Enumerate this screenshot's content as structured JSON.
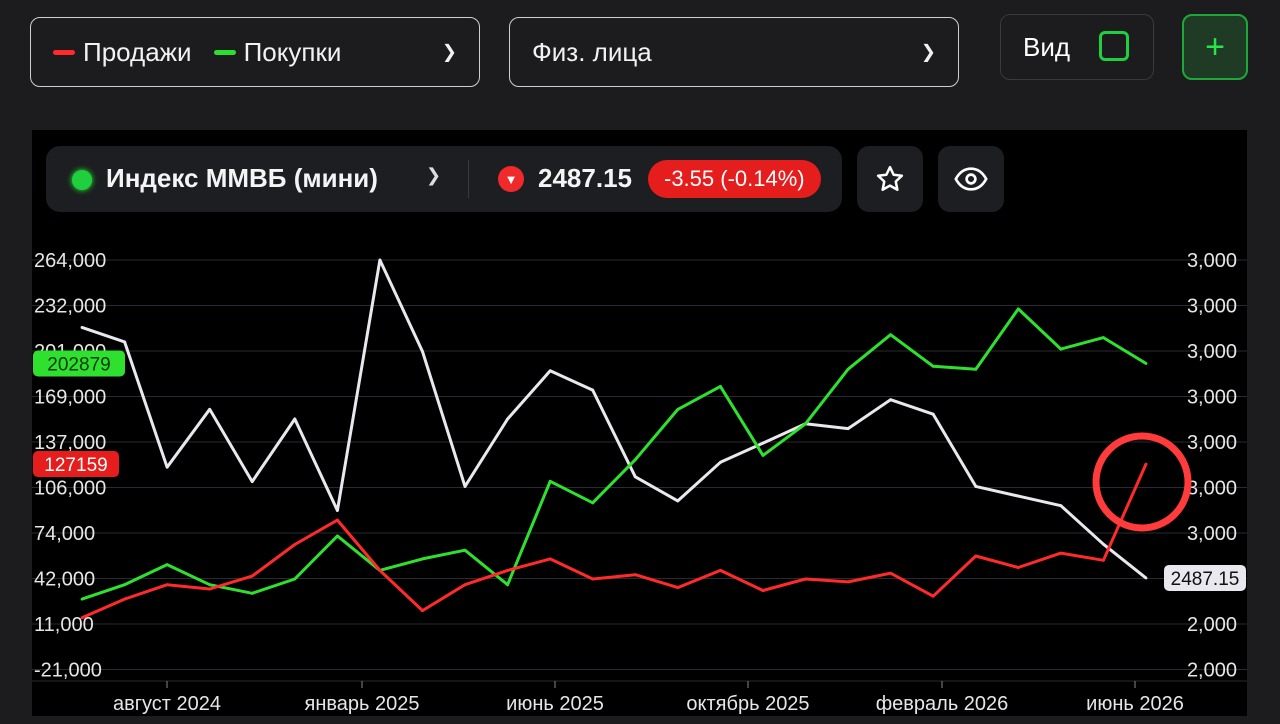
{
  "filters": {
    "series_selector": {
      "items": [
        {
          "label": "Продажи",
          "color": "#ff2a2a"
        },
        {
          "label": "Покупки",
          "color": "#29e02f"
        }
      ]
    },
    "group_selector": {
      "value": "Физ. лица"
    },
    "view_label": "Вид",
    "add_icon": "plus-icon"
  },
  "instrument": {
    "name": "Индекс ММВБ (мини)",
    "price": "2487.15",
    "change": "-3.55 (-0.14%)",
    "status_color": "#1fcf3f",
    "direction_icon": "down-triangle-icon",
    "actions": [
      "star-icon",
      "eye-icon"
    ]
  },
  "chart_data": {
    "type": "line",
    "x_tick_labels": [
      "август 2024",
      "январь 2025",
      "июнь 2025",
      "октябрь 2025",
      "февраль 2026",
      "июнь 2026"
    ],
    "left_axis_ticks": [
      "264,000",
      "232,000",
      "201,000",
      "169,000",
      "137,000",
      "106,000",
      "74,000",
      "42,000",
      "11,000",
      "-21,000"
    ],
    "right_axis_ticks": [
      "3,000",
      "3,000",
      "3,000",
      "3,000",
      "3,000",
      "3,000",
      "3,000",
      "2,000",
      "2,000",
      "2,000"
    ],
    "ylim_left": [
      -21000,
      264000
    ],
    "ylim_right": [
      2300,
      3150
    ],
    "grid": true,
    "series": [
      {
        "name": "Покупки",
        "axis": "left",
        "color": "#2fe12f",
        "last_label": "202879",
        "x": [
          0,
          1,
          2,
          3,
          4,
          5,
          6,
          7,
          8,
          9,
          10,
          11,
          12,
          13,
          14,
          15,
          16,
          17,
          18,
          19,
          20,
          21,
          22,
          23,
          24,
          25
        ],
        "values": [
          28000,
          38000,
          52000,
          38000,
          32000,
          42000,
          72000,
          48000,
          56000,
          62000,
          38000,
          110000,
          95000,
          125000,
          160000,
          176000,
          128000,
          150000,
          188000,
          212000,
          190000,
          188000,
          230000,
          202000,
          210000,
          192000
        ]
      },
      {
        "name": "Продажи",
        "axis": "left",
        "color": "#ff2a2a",
        "last_label": "127159",
        "x": [
          0,
          1,
          2,
          3,
          4,
          5,
          6,
          7,
          8,
          9,
          10,
          11,
          12,
          13,
          14,
          15,
          16,
          17,
          18,
          19,
          20,
          21,
          22,
          23,
          24,
          25
        ],
        "values": [
          15000,
          28000,
          38000,
          35000,
          44000,
          66000,
          83000,
          48000,
          20000,
          38000,
          48000,
          56000,
          42000,
          45000,
          36000,
          48000,
          34000,
          42000,
          40000,
          46000,
          30000,
          58000,
          50000,
          60000,
          55000,
          122000
        ]
      },
      {
        "name": "Индекс ММВБ (мини)",
        "axis": "right",
        "color": "#e8e8ee",
        "last_label": "2487.15",
        "x": [
          0,
          1,
          2,
          3,
          4,
          5,
          6,
          7,
          8,
          9,
          10,
          11,
          12,
          13,
          14,
          15,
          16,
          17,
          18,
          19,
          20,
          21,
          22,
          23,
          24,
          25
        ],
        "values": [
          3010,
          2980,
          2720,
          2840,
          2690,
          2820,
          2630,
          3150,
          2960,
          2680,
          2820,
          2920,
          2880,
          2700,
          2650,
          2730,
          2770,
          2810,
          2800,
          2860,
          2830,
          2680,
          2660,
          2640,
          2560,
          2490
        ]
      }
    ],
    "annotations": [
      {
        "type": "circle",
        "color": "#ff3b3b"
      }
    ]
  }
}
